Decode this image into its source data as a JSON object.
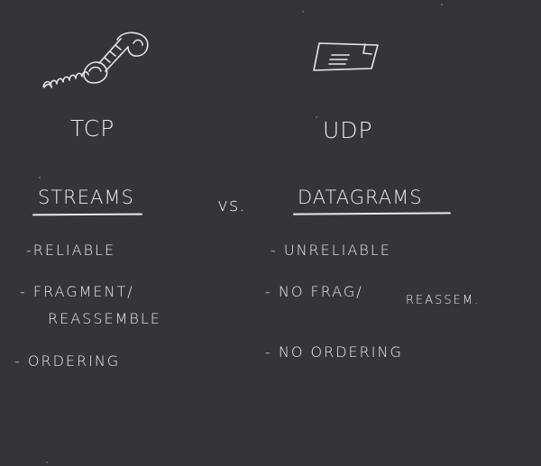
{
  "left": {
    "icon": "telephone-handset-icon",
    "title": "TCP",
    "heading": "Streams",
    "items": [
      "-Reliable",
      "- Fragment/",
      "reassemble",
      "- Ordering"
    ]
  },
  "vs": "vs.",
  "right": {
    "icon": "envelope-icon",
    "title": "UDP",
    "heading": "Datagrams",
    "items": [
      "- Unreliable",
      "- No Frag/",
      "reassem.",
      "- No Ordering"
    ]
  },
  "colors": {
    "board": "#34353b",
    "chalk": "#ececec"
  }
}
